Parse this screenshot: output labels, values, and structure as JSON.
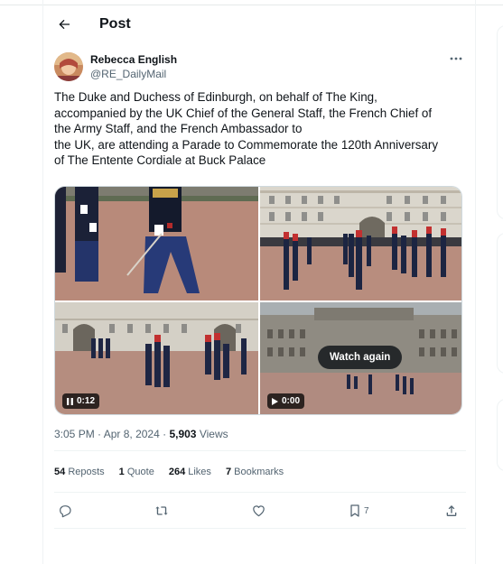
{
  "header": {
    "title": "Post",
    "back_icon": "arrow-left-icon"
  },
  "author": {
    "display_name": "Rebecca English",
    "handle": "@RE_DailyMail",
    "more_icon": "more-horizontal-icon"
  },
  "tweet": {
    "text": "The Duke and Duchess of Edinburgh, on behalf of The King,\naccompanied by the UK Chief of the General Staff, the French Chief of\nthe Army Staff, and the French Ambassador to\nthe UK, are attending a Parade to Commemorate the 120th Anniversary\nof The Entente Cordiale at Buck Palace"
  },
  "media": {
    "video1_time": "0:12",
    "video2_time": "0:00",
    "watch_again": "Watch again"
  },
  "meta": {
    "time": "3:05 PM",
    "sep": "·",
    "date": "Apr 8, 2024",
    "sep2": "·",
    "views_count": "5,903",
    "views_label": "Views"
  },
  "stats": {
    "reposts_count": "54",
    "reposts_label": "Reposts",
    "quotes_count": "1",
    "quotes_label": "Quote",
    "likes_count": "264",
    "likes_label": "Likes",
    "bookmarks_count": "7",
    "bookmarks_label": "Bookmarks"
  },
  "actions": {
    "bookmark_count": "7"
  },
  "colors": {
    "text": "#0f1419",
    "secondary": "#536471",
    "border": "#eff3f4"
  }
}
